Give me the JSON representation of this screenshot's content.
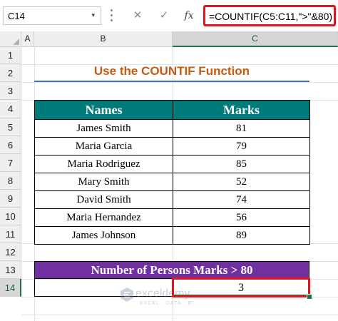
{
  "formula_bar": {
    "name_box": "C14",
    "name_box_arrow": "▾",
    "cancel_icon": "✕",
    "enter_icon": "✓",
    "fx_label": "fx",
    "formula": "=COUNTIF(C5:C11,\">\"&80)"
  },
  "columns": [
    "A",
    "B",
    "C"
  ],
  "rows": [
    "1",
    "2",
    "3",
    "4",
    "5",
    "6",
    "7",
    "8",
    "9",
    "10",
    "11",
    "12",
    "13",
    "14"
  ],
  "selected_cell": "C14",
  "title": "Use the COUNTIF Function",
  "table": {
    "headers": [
      "Names",
      "Marks"
    ],
    "rows": [
      [
        "James Smith",
        "81"
      ],
      [
        "Maria Garcia",
        "79"
      ],
      [
        "Maria Rodriguez",
        "85"
      ],
      [
        "Mary Smith",
        "52"
      ],
      [
        "David Smith",
        "74"
      ],
      [
        "Maria Hernandez",
        "56"
      ],
      [
        "James Johnson",
        "89"
      ]
    ]
  },
  "summary": {
    "label": "Number of Persons Marks > 80",
    "result": "3"
  },
  "watermark": {
    "name": "exceldemy",
    "tagline": "EXCEL · DATA · BI"
  },
  "colors": {
    "header_fill": "#007a7a",
    "summary_fill": "#7030a0",
    "title_color": "#c55a11",
    "highlight_border": "#e0161c",
    "selection": "#217346"
  }
}
